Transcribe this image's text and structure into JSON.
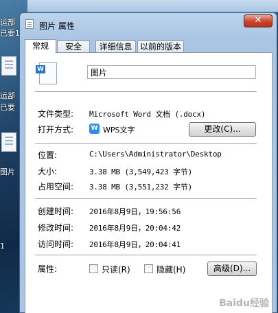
{
  "desktop": {
    "labels": [
      "运部",
      "已要1",
      "运部",
      "已要",
      "图片",
      "1"
    ]
  },
  "dialog": {
    "title": "图片 属性",
    "close_symbol": "✕",
    "tabs": [
      "常规",
      "安全",
      "详细信息",
      "以前的版本"
    ],
    "active_tab": "常规",
    "file_name": "图片",
    "icon_letter": "W",
    "file_type_label": "文件类型:",
    "file_type_value": "Microsoft Word 文档 (.docx)",
    "open_with_label": "打开方式:",
    "open_with_value": "WPS文字",
    "change_button": "更改(C)...",
    "location_label": "位置:",
    "location_value": "C:\\Users\\Administrator\\Desktop",
    "size_label": "大小:",
    "size_value": "3.38 MB (3,549,423 字节)",
    "disk_size_label": "占用空间:",
    "disk_size_value": "3.38 MB (3,551,232 字节)",
    "created_label": "创建时间:",
    "created_value": "2016年8月9日，19:56:56",
    "modified_label": "修改时间:",
    "modified_value": "2016年8月9日，20:04:42",
    "accessed_label": "访问时间:",
    "accessed_value": "2016年8月9日，20:04:41",
    "attributes_label": "属性:",
    "readonly_label": "只读(R)",
    "hidden_label": "隐藏(H)",
    "advanced_button": "高级(D)...",
    "watermark": "Baidu经验"
  },
  "colors": {
    "accent": "#2f8fe6",
    "close_red": "#c9452e"
  }
}
